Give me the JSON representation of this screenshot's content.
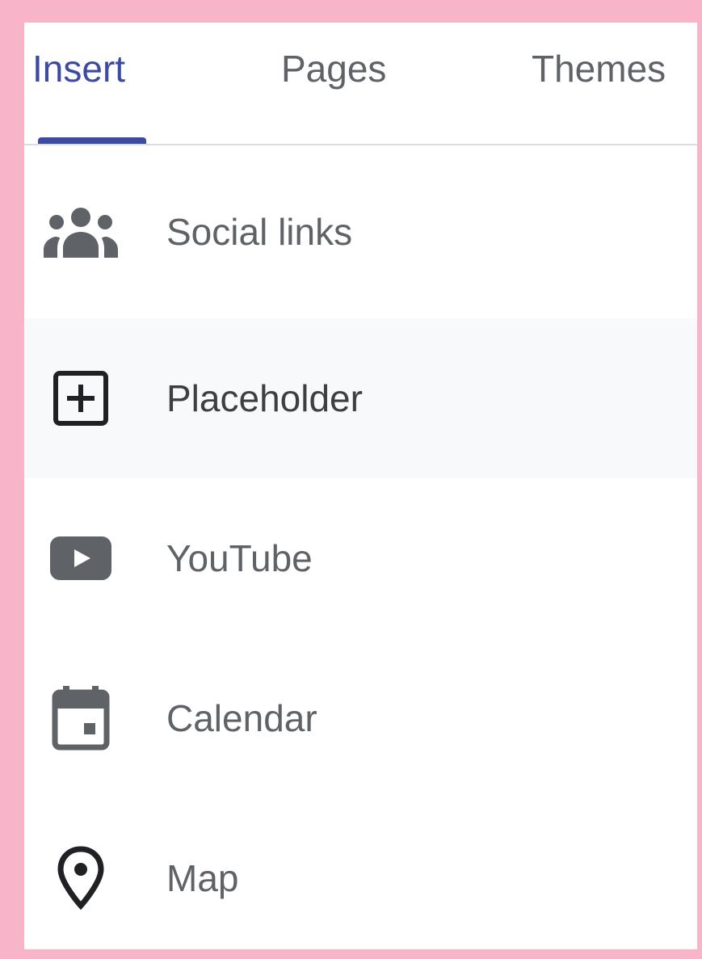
{
  "tabs": [
    {
      "label": "Insert",
      "active": true
    },
    {
      "label": "Pages",
      "active": false
    },
    {
      "label": "Themes",
      "active": false
    }
  ],
  "items": [
    {
      "label": "Social links",
      "icon": "people-group-icon"
    },
    {
      "label": "Placeholder",
      "icon": "plus-box-icon"
    },
    {
      "label": "YouTube",
      "icon": "youtube-play-icon"
    },
    {
      "label": "Calendar",
      "icon": "calendar-icon"
    },
    {
      "label": "Map",
      "icon": "map-pin-icon"
    }
  ],
  "colors": {
    "accent": "#3c4ba1",
    "text": "#5f6368",
    "frame": "#f8b4c9",
    "hover_background": "#f8f9fa"
  }
}
